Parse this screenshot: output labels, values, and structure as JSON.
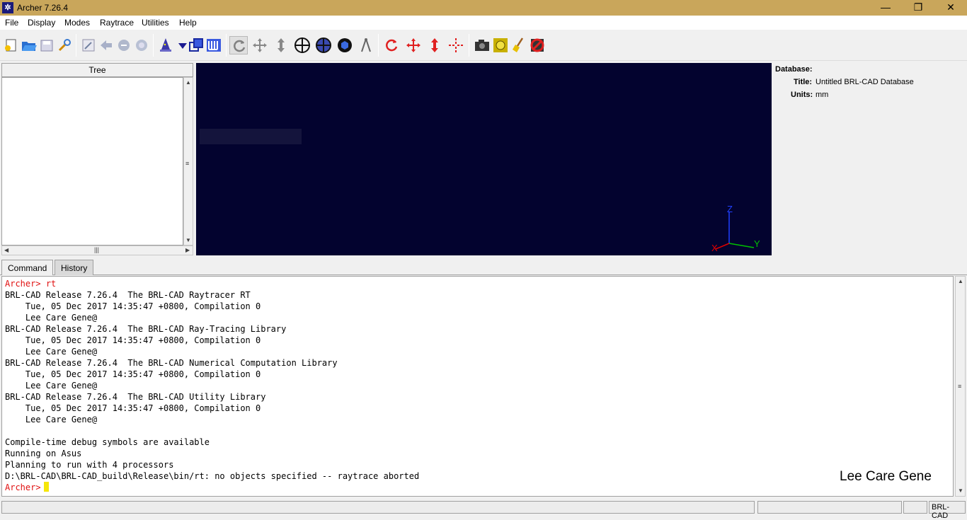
{
  "window": {
    "title": "Archer 7.26.4",
    "icon": "archer-running-man-icon",
    "controls": [
      "minimize-icon",
      "maximize-icon",
      "close-icon"
    ]
  },
  "menu": [
    "File",
    "Display",
    "Modes",
    "Raytrace",
    "Utilities",
    "Help"
  ],
  "toolbar": {
    "icons": [
      "new-database-icon",
      "open-folder-icon",
      "save-icon",
      "preferences-wrench-icon",
      "edit-icon",
      "undo-icon",
      "redo-icon",
      "revert-icon",
      "wizard-icon",
      "dropdown-icon",
      "primitive-icon",
      "combination-icon",
      "rotate-view-icon",
      "translate-view-icon",
      "scale-view-icon",
      "center-view-icon",
      "top-view-icon",
      "iso-view-icon",
      "measure-icon",
      "rotate-object-icon",
      "translate-object-icon",
      "scale-object-icon",
      "center-object-icon",
      "screenshot-camera-icon",
      "raytrace-icon",
      "clear-broom-icon",
      "abort-raytrace-icon"
    ]
  },
  "tree": {
    "header": "Tree"
  },
  "viewport": {
    "axis_labels": {
      "x": "X",
      "y": "Y",
      "z": "Z"
    },
    "colors": {
      "background": "#03032f",
      "x_axis": "#e00000",
      "y_axis": "#00c000",
      "z_axis": "#2040ff"
    }
  },
  "properties": {
    "database_label": "Database:",
    "title_label": "Title:",
    "title_value": "Untitled BRL-CAD Database",
    "units_label": "Units:",
    "units_value": "mm"
  },
  "tabs": [
    {
      "label": "Command",
      "active": true
    },
    {
      "label": "History",
      "active": false
    }
  ],
  "console": {
    "prompt": "Archer>",
    "command": "rt",
    "lines": [
      "BRL-CAD Release 7.26.4  The BRL-CAD Raytracer RT",
      "    Tue, 05 Dec 2017 14:35:47 +0800, Compilation 0",
      "    Lee Care Gene@",
      "BRL-CAD Release 7.26.4  The BRL-CAD Ray-Tracing Library",
      "    Tue, 05 Dec 2017 14:35:47 +0800, Compilation 0",
      "    Lee Care Gene@",
      "BRL-CAD Release 7.26.4  The BRL-CAD Numerical Computation Library",
      "    Tue, 05 Dec 2017 14:35:47 +0800, Compilation 0",
      "    Lee Care Gene@",
      "BRL-CAD Release 7.26.4  The BRL-CAD Utility Library",
      "    Tue, 05 Dec 2017 14:35:47 +0800, Compilation 0",
      "    Lee Care Gene@",
      "",
      "Compile-time debug symbols are available",
      "Running on Asus",
      "Planning to run with 4 processors",
      "D:\\BRL-CAD\\BRL-CAD_build\\Release\\bin/rt: no objects specified -- raytrace aborted"
    ],
    "colors": {
      "prompt": "#e01010",
      "cursor": "#f5e60a"
    }
  },
  "watermark": "Lee Care Gene",
  "status": {
    "right_label": "BRL-CAD"
  }
}
